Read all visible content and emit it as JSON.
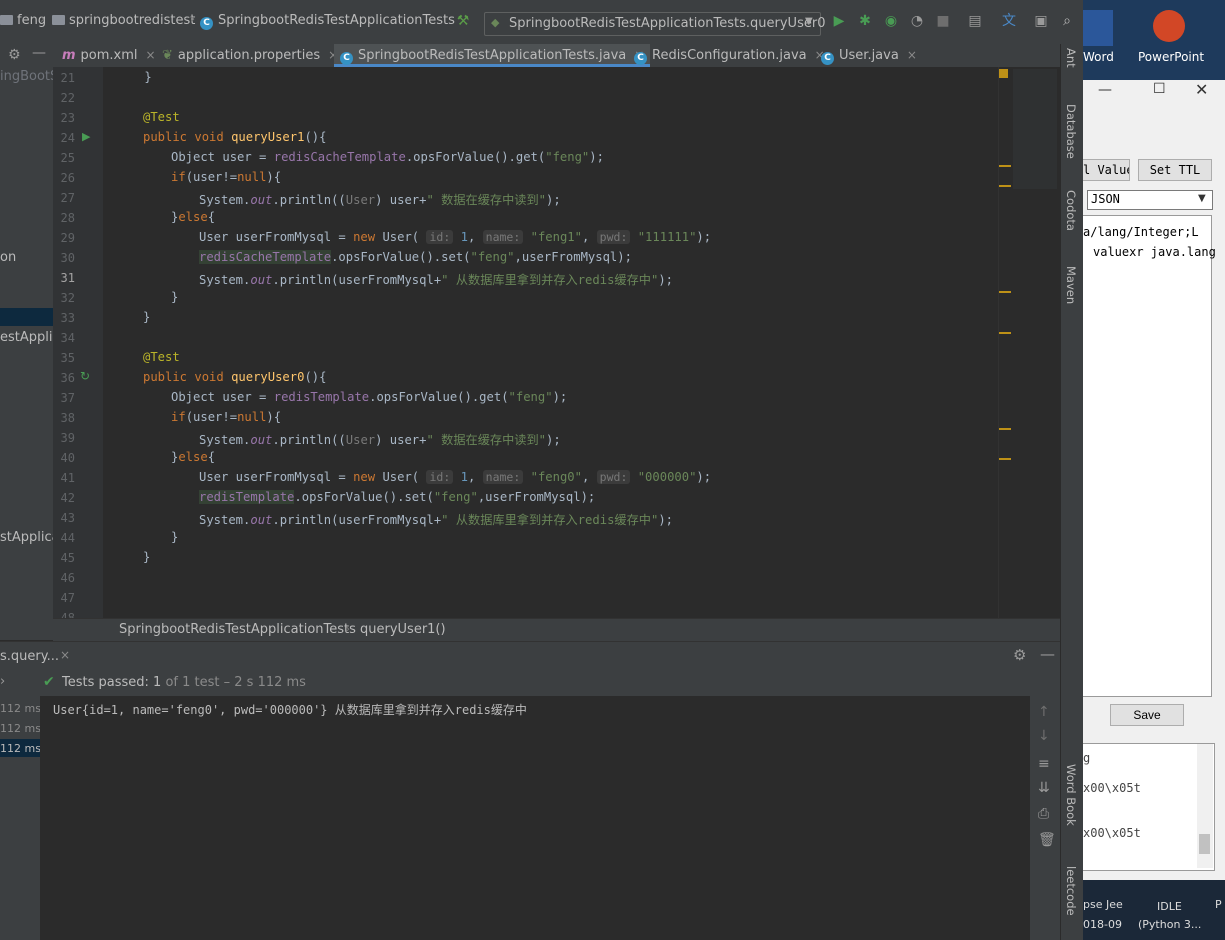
{
  "navbar": {
    "project": "feng",
    "module": "springbootredistest",
    "class": "SpringbootRedisTestApplicationTests",
    "run_config": "SpringbootRedisTestApplicationTests.queryUser0"
  },
  "tabs": [
    {
      "label": "pom.xml",
      "icon": "maven-icon"
    },
    {
      "label": "application.properties",
      "icon": "spring-leaf-icon"
    },
    {
      "label": "SpringbootRedisTestApplicationTests.java",
      "icon": "class-icon"
    },
    {
      "label": "RedisConfiguration.java",
      "icon": "class-icon"
    },
    {
      "label": "User.java",
      "icon": "class-icon"
    }
  ],
  "left_panel": {
    "t1": "ingBootS",
    "t2": "on",
    "t3": "estApplicat",
    "t4": "stApplicat"
  },
  "code": {
    "line_numbers": [
      "21",
      "22",
      "23",
      "24",
      "25",
      "26",
      "27",
      "28",
      "29",
      "30",
      "31",
      "32",
      "33",
      "34",
      "35",
      "36",
      "37",
      "38",
      "39",
      "40",
      "41",
      "42",
      "43",
      "44",
      "45",
      "46",
      "47",
      "48"
    ],
    "l21": "    }",
    "l23": "@Test",
    "l24_kw": "public void ",
    "l24_fn": "queryUser1",
    "l24_rest": "(){",
    "l25_a": "Object user = ",
    "l25_fd": "redisCacheTemplate",
    "l25_b": ".opsForValue().get(",
    "l25_str": "\"feng\"",
    "l25_c": ");",
    "if_kw": "if",
    "if_rest": "(user!=",
    "null_kw": "null",
    "if_end": "){",
    "sys": "System.",
    "out": "out",
    "println": ".println((",
    "user_cast": "User",
    "user_plus": ") user+",
    "cache_str": "\" 数据在缓存中读到\"",
    "close": ");",
    "else_a": "}",
    "else_kw": "else",
    "else_b": "{",
    "u_decl": "User userFromMysql = ",
    "new_kw": "new",
    "user_ctor": " User(",
    "hint_id": "id:",
    "hint_name": "name:",
    "hint_pwd": "pwd:",
    "one": "1",
    "feng1": "\"feng1\"",
    "pwd1": "\"111111\"",
    "feng0": "\"feng0\"",
    "pwd0": "\"000000\"",
    "ctor_end": ");",
    "set_a": ".opsForValue().set(",
    "feng": "\"feng\"",
    "set_b": ",userFromMysql);",
    "println_b": ".println(",
    "ufm_plus": "userFromMysql+",
    "db_str": "\" 从数据库里拿到并存入redis缓存中\"",
    "rbrace": "}",
    "l37_fd": "redisTemplate",
    "l36_fn": "queryUser0",
    "comma": ", "
  },
  "breadcrumb": [
    "SpringbootRedisTestApplicationTests",
    "queryUser1()"
  ],
  "right_tools": [
    "Ant",
    "Database",
    "Codota",
    "Maven",
    "Word Book",
    "leetcode"
  ],
  "run": {
    "tab": "s.query...",
    "status": "Tests passed:",
    "count": "1",
    "of_text": "of 1 test – 2 s 112 ms",
    "times": [
      "112 ms",
      "112 ms",
      "112 ms"
    ],
    "output": "User{id=1, name='feng0', pwd='000000'} 从数据库里拿到并存入redis缓存中"
  },
  "desktop": {
    "word": "Word",
    "powerpoint": "PowerPoint"
  },
  "redis_window": {
    "value_btn": "l Value",
    "ttl_btn": "Set TTL",
    "format": "JSON",
    "text1": "a/lang/Integer;L",
    "text2": "valuexr java.lang",
    "save_btn": "Save",
    "list1": "g",
    "list2": "x00\\x05t",
    "list3": "x00\\x05t"
  },
  "taskbar": {
    "a": "pse Jee",
    "b": "018-09",
    "c": "IDLE",
    "d": "(Python 3...",
    "e": "P"
  },
  "colors": {
    "accent": "#4a88c7",
    "pass_green": "#499c54",
    "marker_yellow": "#be9117"
  }
}
